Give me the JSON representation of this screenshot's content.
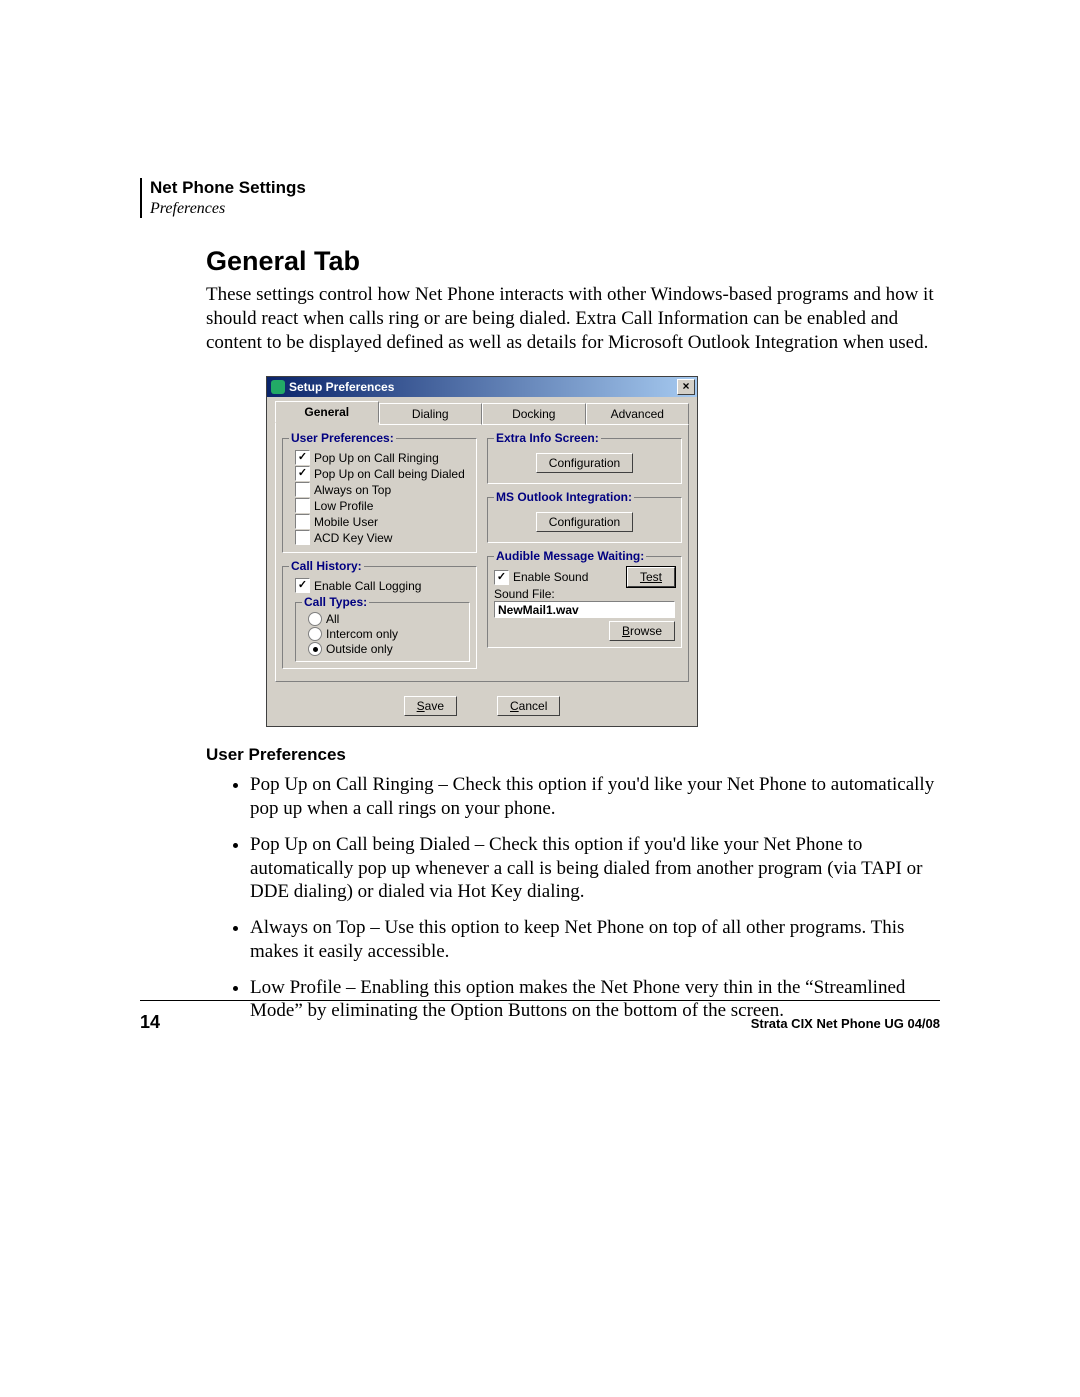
{
  "header": {
    "section": "Net Phone Settings",
    "sub": "Preferences"
  },
  "heading": "General Tab",
  "intro": "These settings control how Net Phone interacts with other Windows-based programs and how it should react when calls ring or are being dialed.  Extra Call Information can be enabled and content to be displayed defined as well as details for Microsoft Outlook Integration when used.",
  "dialog": {
    "title": "Setup Preferences",
    "close_glyph": "×",
    "tabs": {
      "general": "General",
      "dialing": "Dialing",
      "docking": "Docking",
      "advanced": "Advanced"
    },
    "groups": {
      "user_prefs": {
        "legend": "User Preferences:",
        "items": {
          "popup_ring": {
            "label": "Pop Up on Call Ringing",
            "checked": true
          },
          "popup_dialed": {
            "label": "Pop Up on Call being Dialed",
            "checked": true
          },
          "always_top": {
            "label": "Always on Top",
            "checked": false
          },
          "low_profile": {
            "label": "Low Profile",
            "checked": false
          },
          "mobile_user": {
            "label": "Mobile User",
            "checked": false
          },
          "acd_key": {
            "label": "ACD Key View",
            "checked": false
          }
        }
      },
      "call_history": {
        "legend": "Call History:",
        "enable_logging": {
          "label": "Enable Call Logging",
          "checked": true
        },
        "call_types": {
          "legend": "Call Types:",
          "options": {
            "all": {
              "label": "All",
              "selected": false
            },
            "intercom": {
              "label": "Intercom only",
              "selected": false
            },
            "outside": {
              "label": "Outside only",
              "selected": true
            }
          }
        }
      },
      "extra_info": {
        "legend": "Extra Info Screen:",
        "button": "Configuration"
      },
      "outlook": {
        "legend": "MS Outlook Integration:",
        "button": "Configuration"
      },
      "audible": {
        "legend": "Audible Message Waiting:",
        "enable_sound": {
          "label": "Enable Sound",
          "checked": true
        },
        "test_btn": "Test",
        "sound_file_label": "Sound File:",
        "sound_file_value": "NewMail1.wav",
        "browse_btn": "Browse"
      }
    },
    "buttons": {
      "save": "Save",
      "cancel": "Cancel"
    }
  },
  "subheading": "User Preferences",
  "bullets": [
    "Pop Up on Call Ringing – Check this option if you'd like your Net Phone to automatically pop up when a call rings on your phone.",
    "Pop Up on Call being Dialed – Check this option if you'd like your Net Phone to automatically pop up whenever a call is being dialed from another program (via TAPI or DDE dialing) or dialed via Hot Key dialing.",
    "Always on Top – Use this option to keep Net Phone on top of all other programs. This makes it easily accessible.",
    "Low Profile – Enabling this option makes the Net Phone very thin in the “Streamlined Mode” by eliminating the Option Buttons on the bottom of the screen."
  ],
  "footer": {
    "page": "14",
    "doc": "Strata CIX Net Phone UG    04/08"
  }
}
